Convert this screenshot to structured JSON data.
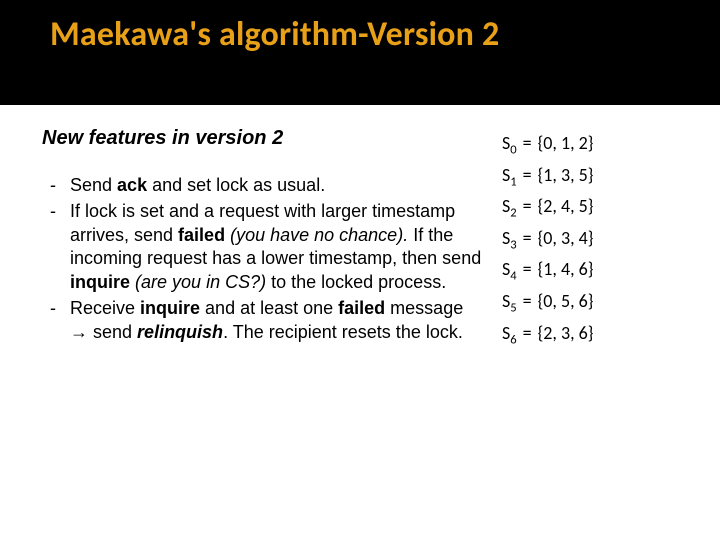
{
  "title": "Maekawa's algorithm-Version 2",
  "subhead": "New features in version 2",
  "bullets": [
    "Send <b>ack</b> and set lock as usual.",
    "If lock is set and a request with larger timestamp arrives, send <b>failed</b> <i>(you have no chance).</i> If the incoming request has a lower timestamp, then send <b>inquire</b> <i>(are you in CS?)</i> to the locked process.",
    "Receive <b>inquire</b> and at least one <b>failed</b> message → send <b><i>relinquish</i></b>. The recipient resets the lock."
  ],
  "sets": [
    {
      "label": "S",
      "sub": "0",
      "eq": "=",
      "val": "{0, 1, 2}"
    },
    {
      "label": "S",
      "sub": "1",
      "eq": "=",
      "val": "{1, 3, 5}"
    },
    {
      "label": "S",
      "sub": "2",
      "eq": "=",
      "val": "{2, 4, 5}"
    },
    {
      "label": "S",
      "sub": "3",
      "eq": "=",
      "val": "{0, 3, 4}"
    },
    {
      "label": "S",
      "sub": "4",
      "eq": "=",
      "val": "{1, 4, 6}"
    },
    {
      "label": "S",
      "sub": "5",
      "eq": "=",
      "val": "{0, 5, 6}"
    },
    {
      "label": "S",
      "sub": "6",
      "eq": "=",
      "val": "{2, 3, 6}"
    }
  ]
}
